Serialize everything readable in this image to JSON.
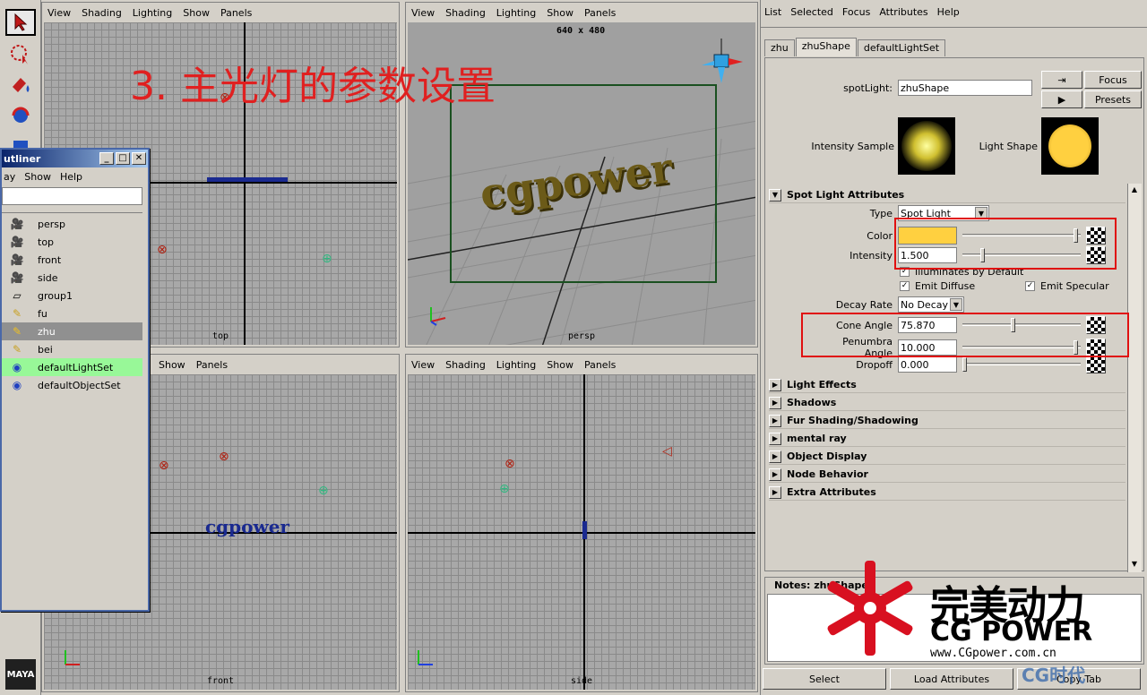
{
  "toolbox": {
    "tools": [
      "select-arrow-icon",
      "lasso-icon",
      "paint-icon",
      "rotate-icon",
      "shapes-icon"
    ],
    "logo": "MAYA"
  },
  "overlay_title": "3. 主光灯的参数设置",
  "viewports": {
    "top": {
      "menu": [
        "View",
        "Shading",
        "Lighting",
        "Show",
        "Panels"
      ],
      "label": "top"
    },
    "persp": {
      "menu": [
        "View",
        "Shading",
        "Lighting",
        "Show",
        "Panels"
      ],
      "label": "persp",
      "resolution": "640 x 480",
      "scene_text": "cgpower"
    },
    "front": {
      "menu": [
        "Show",
        "Panels"
      ],
      "label": "front",
      "scene_text": "cgpower"
    },
    "side": {
      "menu": [
        "View",
        "Shading",
        "Lighting",
        "Show",
        "Panels"
      ],
      "label": "side"
    }
  },
  "outliner": {
    "title": "utliner",
    "menu": [
      "ay",
      "Show",
      "Help"
    ],
    "items": [
      {
        "label": "persp",
        "icon": "camera-icon"
      },
      {
        "label": "top",
        "icon": "camera-icon"
      },
      {
        "label": "front",
        "icon": "camera-icon"
      },
      {
        "label": "side",
        "icon": "camera-icon"
      },
      {
        "label": "group1",
        "icon": "group-icon"
      },
      {
        "label": "fu",
        "icon": "spotlight-icon"
      },
      {
        "label": "zhu",
        "icon": "spotlight-icon",
        "state": "selected"
      },
      {
        "label": "bei",
        "icon": "spotlight-icon"
      },
      {
        "label": "defaultLightSet",
        "icon": "set-icon",
        "state": "highlight"
      },
      {
        "label": "defaultObjectSet",
        "icon": "set-icon"
      }
    ]
  },
  "attr_editor": {
    "menu": [
      "List",
      "Selected",
      "Focus",
      "Attributes",
      "Help"
    ],
    "tabs": [
      "zhu",
      "zhuShape",
      "defaultLightSet"
    ],
    "active_tab": "zhuShape",
    "node_label": "spotLight:",
    "node_value": "zhuShape",
    "focus_label": "Focus",
    "presets_label": "Presets",
    "intensity_sample_label": "Intensity Sample",
    "light_shape_label": "Light Shape",
    "section_spot": "Spot Light Attributes",
    "type_label": "Type",
    "type_value": "Spot Light",
    "color_label": "Color",
    "color_value": "#ffd040",
    "intensity_label": "Intensity",
    "intensity_value": "1.500",
    "illum_label": "Illuminates by Default",
    "emit_diffuse_label": "Emit Diffuse",
    "emit_specular_label": "Emit Specular",
    "decay_label": "Decay Rate",
    "decay_value": "No Decay",
    "cone_label": "Cone Angle",
    "cone_value": "75.870",
    "penumbra_label": "Penumbra Angle",
    "penumbra_value": "10.000",
    "dropoff_label": "Dropoff",
    "dropoff_value": "0.000",
    "sections": [
      "Light Effects",
      "Shadows",
      "Fur Shading/Shadowing",
      "mental ray",
      "Object Display",
      "Node Behavior",
      "Extra Attributes"
    ],
    "notes_label": "Notes: zhuShape",
    "buttons": [
      "Select",
      "Load Attributes",
      "Copy Tab"
    ]
  },
  "watermark": {
    "cn": "完美动力",
    "en": "CG POWER",
    "url": "www.CGpower.com.cn",
    "corner": "CG时代",
    "brand_color": "#d81020"
  }
}
